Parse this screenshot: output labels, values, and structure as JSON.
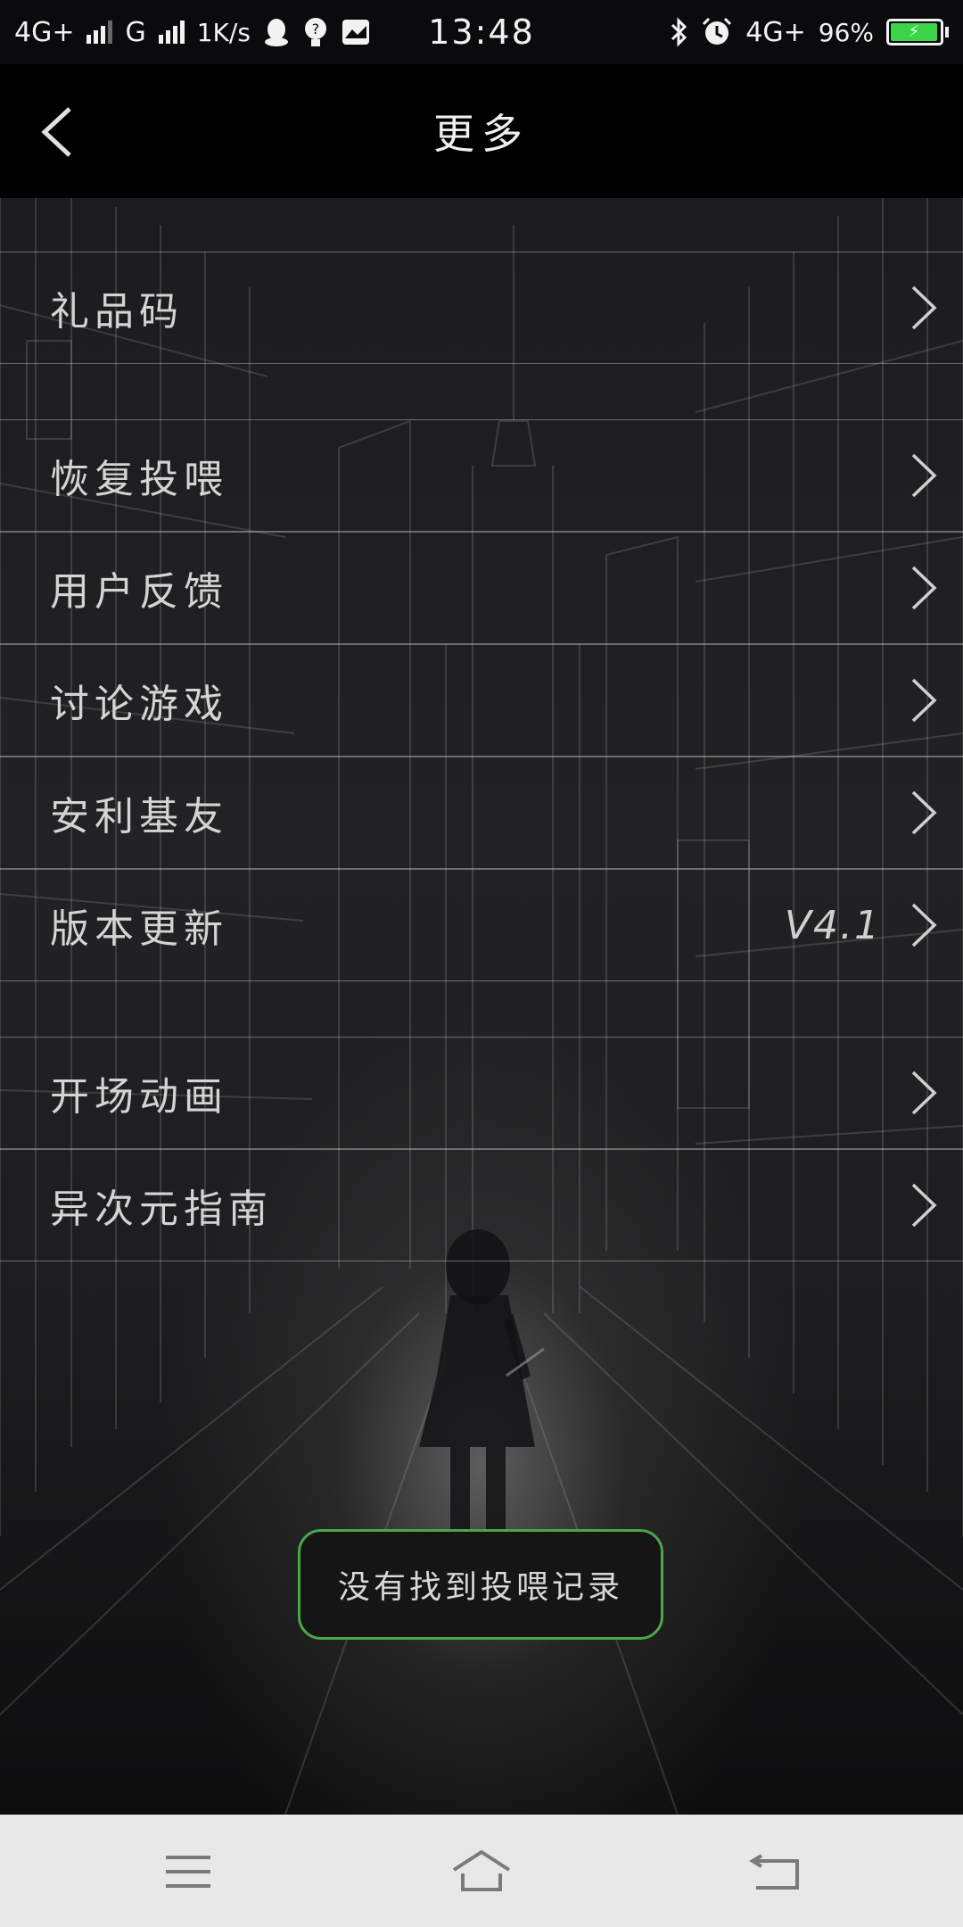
{
  "status_bar": {
    "network1": "4G+",
    "network2": "G",
    "speed": "1K/s",
    "time": "13:48",
    "network3": "4G+",
    "battery": "96%",
    "icons": [
      "qq-icon",
      "help-bulb-icon",
      "mail-icon",
      "bluetooth-icon",
      "alarm-icon"
    ]
  },
  "header": {
    "title": "更多",
    "back_icon": "chevron-left-icon"
  },
  "menu": {
    "items": [
      {
        "label": "礼品码",
        "value": ""
      },
      {
        "label": "恢复投喂",
        "value": ""
      },
      {
        "label": "用户反馈",
        "value": ""
      },
      {
        "label": "讨论游戏",
        "value": ""
      },
      {
        "label": "安利基友",
        "value": ""
      },
      {
        "label": "版本更新",
        "value": "V4.1"
      },
      {
        "label": "开场动画",
        "value": ""
      },
      {
        "label": "异次元指南",
        "value": ""
      }
    ],
    "chevron_icon": "chevron-right-icon"
  },
  "toast": {
    "text": "没有找到投喂记录",
    "border_color": "#4ba64a"
  },
  "nav_bar": {
    "icons": [
      "menu-icon",
      "home-icon",
      "back-icon"
    ]
  },
  "colors": {
    "battery_fill": "#3bd44a",
    "background": "#1c1c1e"
  }
}
